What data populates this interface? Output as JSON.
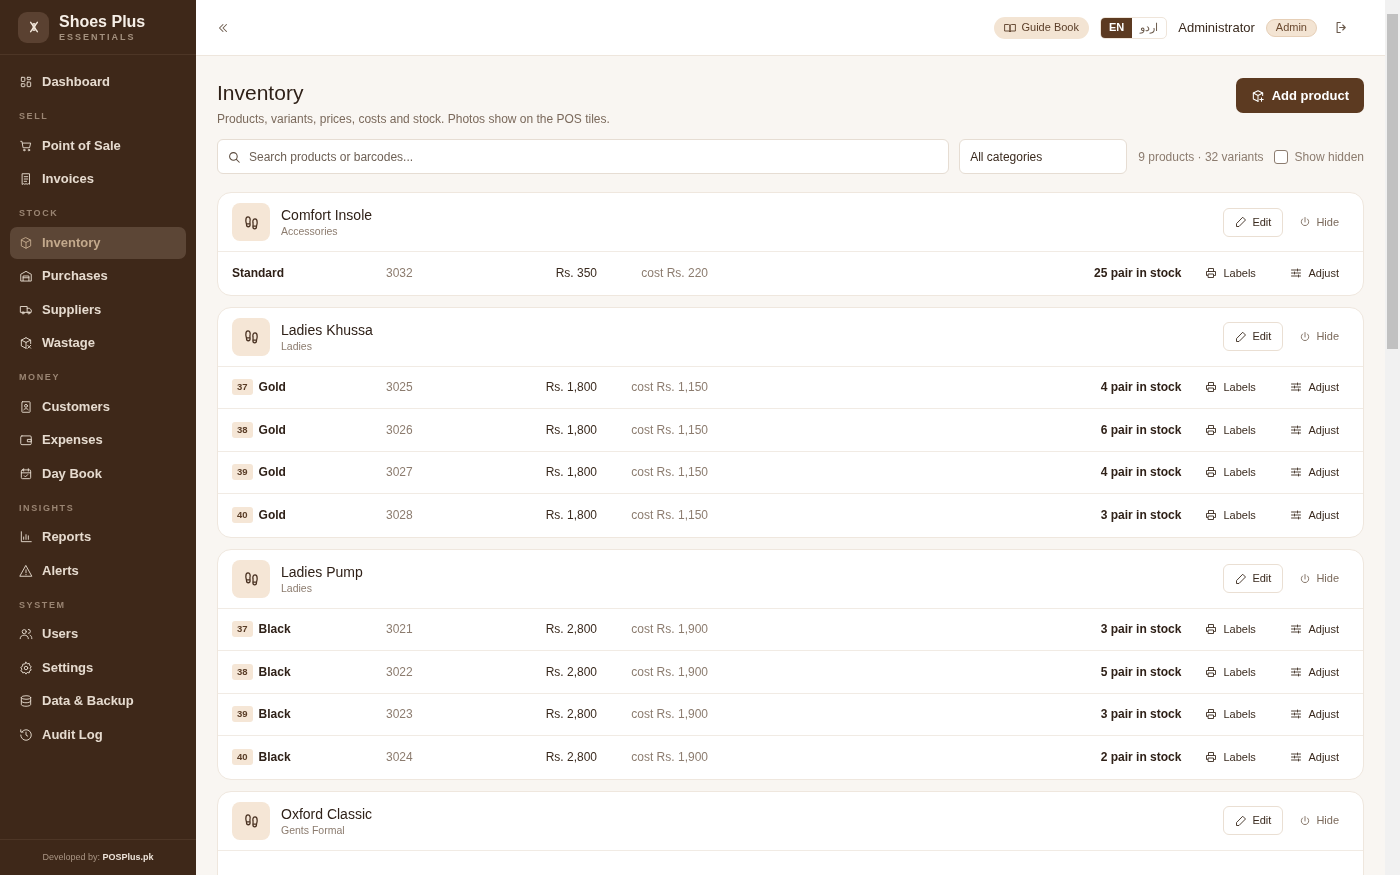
{
  "sidebar": {
    "brand": {
      "name": "Shoes Plus",
      "tagline": "ESSENTIALS"
    },
    "sections": [
      {
        "items": [
          {
            "label": "Dashboard",
            "selected": false
          }
        ]
      },
      {
        "heading": "SELL",
        "items": [
          {
            "label": "Point of Sale",
            "selected": false
          },
          {
            "label": "Invoices",
            "selected": false
          }
        ]
      },
      {
        "heading": "STOCK",
        "items": [
          {
            "label": "Inventory",
            "selected": true
          },
          {
            "label": "Purchases",
            "selected": false
          },
          {
            "label": "Suppliers",
            "selected": false
          },
          {
            "label": "Wastage",
            "selected": false
          }
        ]
      },
      {
        "heading": "MONEY",
        "items": [
          {
            "label": "Customers",
            "selected": false
          },
          {
            "label": "Expenses",
            "selected": false
          },
          {
            "label": "Day Book",
            "selected": false
          }
        ]
      },
      {
        "heading": "INSIGHTS",
        "items": [
          {
            "label": "Reports",
            "selected": false
          },
          {
            "label": "Alerts",
            "selected": false
          }
        ]
      },
      {
        "heading": "SYSTEM",
        "items": [
          {
            "label": "Users",
            "selected": false
          },
          {
            "label": "Settings",
            "selected": false
          },
          {
            "label": "Data & Backup",
            "selected": false
          },
          {
            "label": "Audit Log",
            "selected": false
          }
        ]
      }
    ],
    "footer": "Developed by: **POSPlus.pk**"
  },
  "topbar": {
    "guide": "Guide Book",
    "languages": [
      {
        "label": "EN",
        "selected": true
      },
      {
        "label": "اردو",
        "selected": false
      }
    ],
    "user": "Administrator",
    "role": "Admin"
  },
  "page": {
    "title": "Inventory",
    "subtitle": "Products, variants, prices, costs and stock. Photos show on the POS tiles.",
    "add_button": "Add product"
  },
  "filters": {
    "search": {
      "placeholder": "Search products or barcodes..."
    },
    "category": "All categories",
    "summary": "9 products · 32 variants",
    "show_hidden": {
      "label": "Show hidden",
      "checked": false
    }
  },
  "products": [
    {
      "name": "Comfort Insole",
      "category": "Accessories",
      "actions": [
        "Edit",
        "Hide"
      ],
      "variants": [
        {
          "name": "Standard",
          "barcode": "3032",
          "price": "Rs. 350",
          "cost": "cost Rs. 220",
          "stock": "25 pair in stock",
          "low": false,
          "actions": [
            "Labels",
            "Adjust"
          ]
        }
      ]
    },
    {
      "name": "Ladies Khussa",
      "category": "Ladies",
      "actions": [
        "Edit",
        "Hide"
      ],
      "variants": [
        {
          "size": "37",
          "name": "Gold",
          "barcode": "3025",
          "price": "Rs. 1,800",
          "cost": "cost Rs. 1,150",
          "stock": "4 pair in stock",
          "low": false,
          "actions": [
            "Labels",
            "Adjust"
          ]
        },
        {
          "size": "38",
          "name": "Gold",
          "barcode": "3026",
          "price": "Rs. 1,800",
          "cost": "cost Rs. 1,150",
          "stock": "6 pair in stock",
          "low": false,
          "actions": [
            "Labels",
            "Adjust"
          ]
        },
        {
          "size": "39",
          "name": "Gold",
          "barcode": "3027",
          "price": "Rs. 1,800",
          "cost": "cost Rs. 1,150",
          "stock": "4 pair in stock",
          "low": false,
          "actions": [
            "Labels",
            "Adjust"
          ]
        },
        {
          "size": "40",
          "name": "Gold",
          "barcode": "3028",
          "price": "Rs. 1,800",
          "cost": "cost Rs. 1,150",
          "stock": "3 pair in stock",
          "low": false,
          "actions": [
            "Labels",
            "Adjust"
          ]
        }
      ]
    },
    {
      "name": "Ladies Pump",
      "category": "Ladies",
      "actions": [
        "Edit",
        "Hide"
      ],
      "variants": [
        {
          "size": "37",
          "name": "Black",
          "barcode": "3021",
          "price": "Rs. 2,800",
          "cost": "cost Rs. 1,900",
          "stock": "3 pair in stock",
          "low": false,
          "actions": [
            "Labels",
            "Adjust"
          ]
        },
        {
          "size": "38",
          "name": "Black",
          "barcode": "3022",
          "price": "Rs. 2,800",
          "cost": "cost Rs. 1,900",
          "stock": "5 pair in stock",
          "low": false,
          "actions": [
            "Labels",
            "Adjust"
          ]
        },
        {
          "size": "39",
          "name": "Black",
          "barcode": "3023",
          "price": "Rs. 2,800",
          "cost": "cost Rs. 1,900",
          "stock": "3 pair in stock",
          "low": false,
          "actions": [
            "Labels",
            "Adjust"
          ]
        },
        {
          "size": "40",
          "name": "Black",
          "barcode": "3024",
          "price": "Rs. 2,800",
          "cost": "cost Rs. 1,900",
          "stock": "2 pair in stock",
          "low": false,
          "actions": [
            "Labels",
            "Adjust"
          ]
        }
      ]
    },
    {
      "name": "Oxford Classic",
      "category": "Gents Formal",
      "actions": [
        "Edit",
        "Hide"
      ]
    }
  ]
}
